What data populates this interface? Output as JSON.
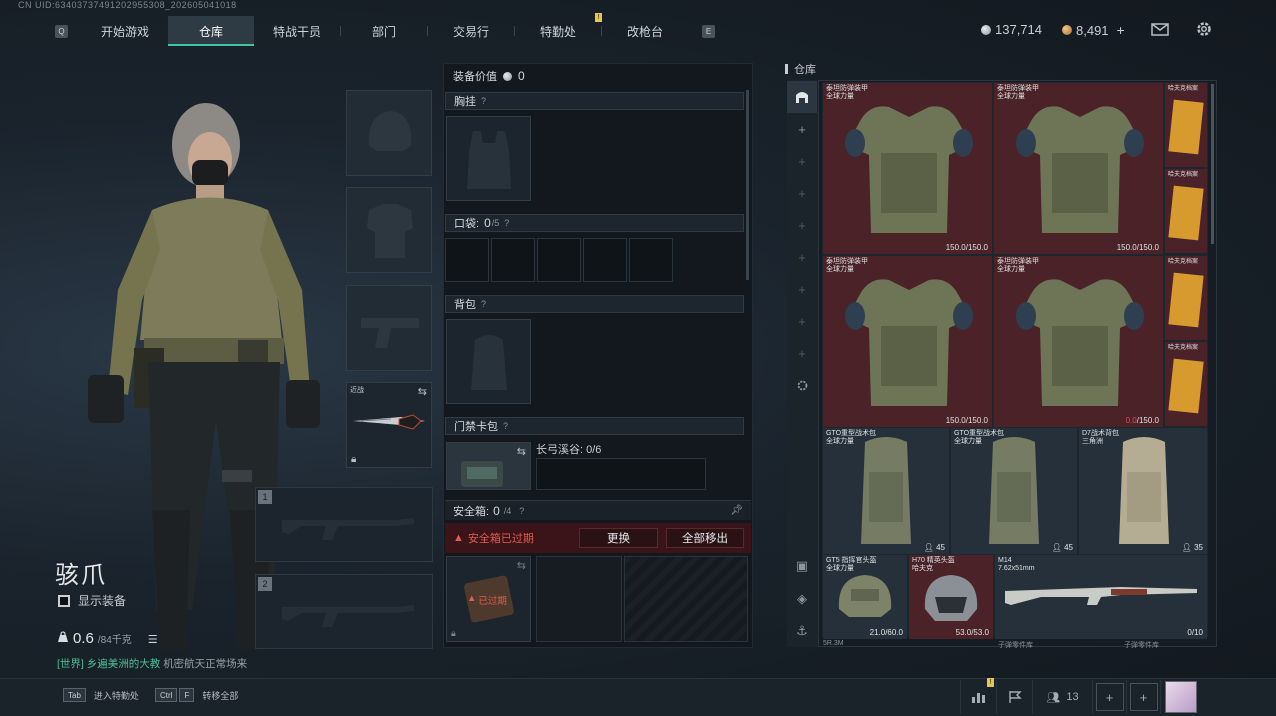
{
  "uid_text": "CN UID:63403737491202955308_202605041018",
  "nav": {
    "left_key": "Q",
    "right_key": "E",
    "tabs": [
      {
        "label": "开始游戏",
        "active": false
      },
      {
        "label": "仓库",
        "active": true
      },
      {
        "label": "特战干员",
        "active": false
      },
      {
        "label": "部门",
        "active": false
      },
      {
        "label": "交易行",
        "active": false
      },
      {
        "label": "特勤处",
        "active": false
      },
      {
        "label": "改枪台",
        "active": false
      }
    ],
    "notice_badge": "!"
  },
  "currency": {
    "primary": "137,714",
    "secondary": "8,491",
    "add_label": "+"
  },
  "character": {
    "name": "骇爪",
    "show_equipment_label": "显示装备",
    "weight_value": "0.6",
    "weight_unit": "/84千克",
    "chat_channel": "[世界]",
    "chat_user": "乡遍美洲的大教",
    "chat_message": "机密航天正常场来"
  },
  "equip_slots": {
    "melee_label": "近战",
    "weapon_slot_1_num": "1",
    "weapon_slot_2_num": "2"
  },
  "loadout": {
    "equip_value_label": "装备价值",
    "equip_value": "0",
    "chest_rig_label": "胸挂",
    "pockets_label": "口袋:",
    "pockets_count": "0",
    "pockets_max": "/5",
    "backpack_label": "背包",
    "keycard_label": "门禁卡包",
    "keycard_location": "长弓溪谷: 0/6",
    "safebox_label": "安全箱:",
    "safebox_count": "0",
    "safebox_max": "/4",
    "safebox_expired_label": "安全箱已过期",
    "replace_button": "更换",
    "move_all_button": "全部移出",
    "expired_tag": "已过期",
    "help": "?"
  },
  "stash": {
    "title": "仓库",
    "items": [
      {
        "name": "泰坦防弹装甲",
        "sub": "全球力量",
        "value": "150.0/150.0",
        "red": false
      },
      {
        "name": "泰坦防弹装甲",
        "sub": "全球力量",
        "value": "150.0/150.0",
        "red": false
      },
      {
        "name": "泰坦防弹装甲",
        "sub": "全球力量",
        "value": "150.0/150.0",
        "red": false
      },
      {
        "name": "泰坦防弹装甲",
        "sub": "全球力量",
        "value_bad": "0.0",
        "value_rest": "/150.0",
        "red": true
      },
      {
        "name": "GTO重型战术包",
        "sub": "全球力量",
        "value": "45"
      },
      {
        "name": "GTO重型战术包",
        "sub": "全球力量",
        "value": "45"
      },
      {
        "name": "D7战术背包",
        "sub": "三角洲",
        "value": "35"
      },
      {
        "name": "GT5 指挥官头盔",
        "sub": "全球力量",
        "value": "21.0/60.0"
      },
      {
        "name": "H70 精英头盔",
        "sub": "哈夫克",
        "value": "53.0/53.0"
      },
      {
        "name": "M14",
        "sub": "7.62x51mm",
        "value": "0/10"
      }
    ],
    "side_docs": [
      {
        "label": "哈夫克档案"
      },
      {
        "label": "哈夫克档案"
      },
      {
        "label": "哈夫克档案"
      },
      {
        "label": "哈夫克档案"
      }
    ],
    "footer_left": "5R.3M",
    "footer_mid": "子弹零件库",
    "footer_right": "子弹零件库"
  },
  "bottom": {
    "hint1_key": "Tab",
    "hint1_label": "进入特勤处",
    "hint2_key_a": "Ctrl",
    "hint2_key_b": "F",
    "hint2_label": "转移全部",
    "friends_count": "13",
    "notice_badge": "!"
  }
}
